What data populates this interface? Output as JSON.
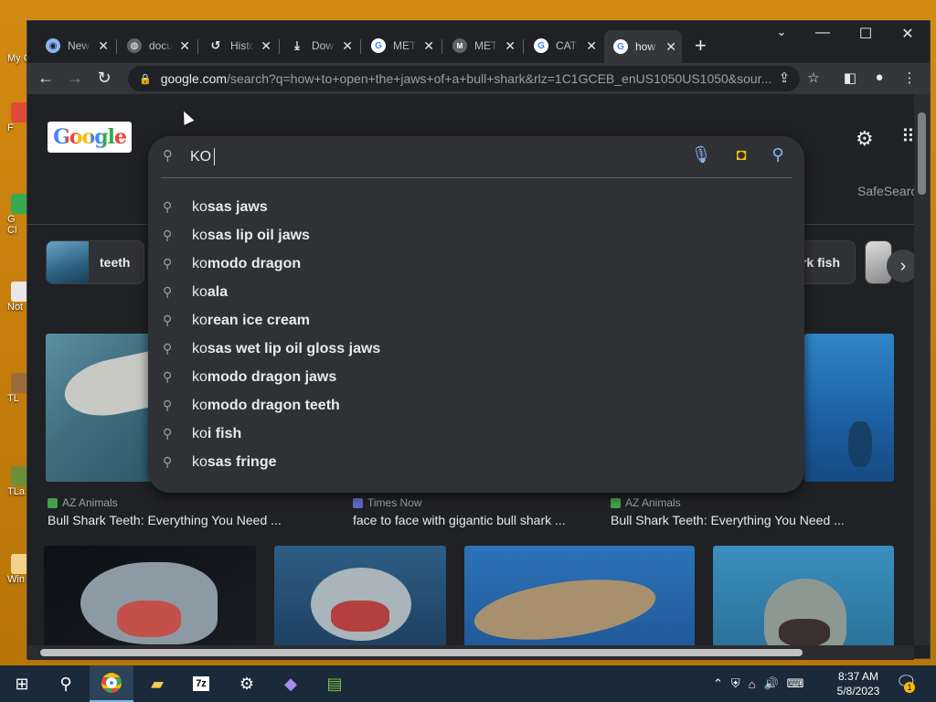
{
  "desktop": {
    "icons": [
      {
        "label": "My C",
        "color": "#5a8fd8"
      },
      {
        "label": "F",
        "color": "#e04a3a"
      },
      {
        "label": "G\nCl",
        "color": "#39a852"
      },
      {
        "label": "Not",
        "color": "#e8e8e8"
      },
      {
        "label": "TL",
        "color": "#9c6b3c"
      },
      {
        "label": "TLa",
        "color": "#6e8f3a"
      },
      {
        "label": "Win",
        "color": "#f2d28a"
      }
    ]
  },
  "browser": {
    "tabs": [
      {
        "label": "New",
        "icon": "chrome-icon",
        "color": "#8ab4f8"
      },
      {
        "label": "docu",
        "icon": "globe-icon",
        "color": "#9aa0a6"
      },
      {
        "label": "Histo",
        "icon": "history-icon",
        "color": "#9aa0a6"
      },
      {
        "label": "Dow",
        "icon": "download-icon",
        "color": "#9aa0a6"
      },
      {
        "label": "META",
        "icon": "google-icon",
        "color": "#ea4335"
      },
      {
        "label": "META",
        "icon": "m-badge-icon",
        "color": "#5f6368"
      },
      {
        "label": "CAT",
        "icon": "google-icon",
        "color": "#ea4335"
      },
      {
        "label": "how",
        "icon": "google-icon",
        "color": "#ea4335",
        "active": true
      }
    ],
    "new_tab_glyph": "+",
    "url_host": "google.com",
    "url_rest": "/search?q=how+to+open+the+jaws+of+a+bull+shark&rlz=1C1GCEB_enUS1050US1050&sour..."
  },
  "page": {
    "logo_text": "Google",
    "safesearch_label": "SafeSearch",
    "chips": [
      {
        "label": "teeth"
      },
      {
        "label": "rk fish"
      }
    ],
    "results_row1": [
      {
        "source": "AZ Animals",
        "title": "Bull Shark Teeth: Everything You Need ...",
        "src_color": "#43a047"
      },
      {
        "source": "Times Now",
        "title": "face to face with gigantic bull shark ...",
        "src_color": "#5c6bc0"
      },
      {
        "source": "AZ Animals",
        "title": "Bull Shark Teeth: Everything You Need ...",
        "src_color": "#43a047"
      }
    ]
  },
  "search": {
    "query": "KO",
    "suggestions": [
      {
        "prefix": "ko",
        "rest": "sas jaws"
      },
      {
        "prefix": "ko",
        "rest": "sas lip oil jaws"
      },
      {
        "prefix": "ko",
        "rest": "modo dragon"
      },
      {
        "prefix": "ko",
        "rest": "ala"
      },
      {
        "prefix": "ko",
        "rest": "rean ice cream"
      },
      {
        "prefix": "ko",
        "rest": "sas wet lip oil gloss jaws"
      },
      {
        "prefix": "ko",
        "rest": "modo dragon jaws"
      },
      {
        "prefix": "ko",
        "rest": "modo dragon teeth"
      },
      {
        "prefix": "ko",
        "rest": "i fish"
      },
      {
        "prefix": "ko",
        "rest": "sas fringe"
      }
    ]
  },
  "taskbar": {
    "time": "8:37 AM",
    "date": "5/8/2023",
    "notification_count": "1"
  }
}
